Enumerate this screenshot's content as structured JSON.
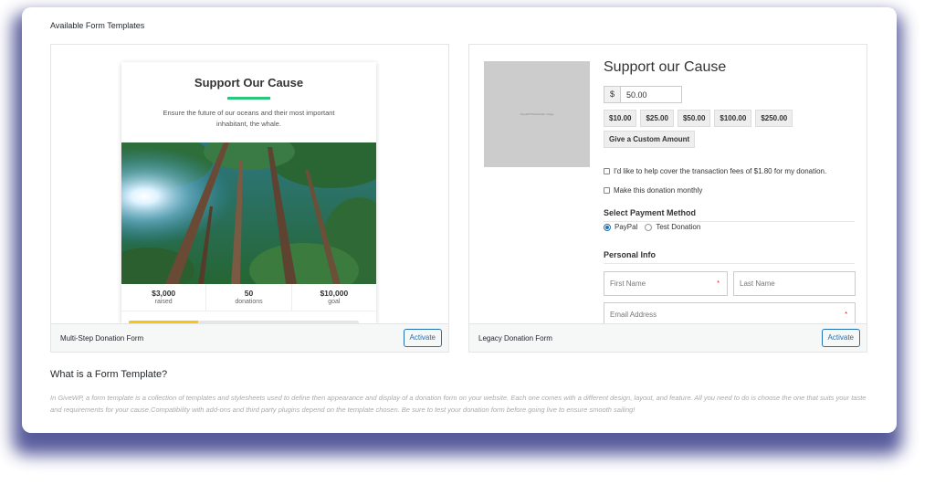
{
  "section_title": "Available Form Templates",
  "templates": [
    {
      "name": "Multi-Step Donation Form",
      "activate_label": "Activate",
      "preview": {
        "heading": "Support Our Cause",
        "description": "Ensure the future of our oceans and their most important inhabitant, the whale.",
        "stats": [
          {
            "value": "$3,000",
            "label": "raised"
          },
          {
            "value": "50",
            "label": "donations"
          },
          {
            "value": "$10,000",
            "label": "goal"
          }
        ],
        "progress_fraction": 0.3,
        "accent_color": "#28c77b",
        "progress_color": "#f5c518"
      }
    },
    {
      "name": "Legacy Donation Form",
      "activate_label": "Activate",
      "preview": {
        "image_placeholder": "GiveWP Placeholder Image",
        "heading": "Support our Cause",
        "currency_symbol": "$",
        "amount_value": "50.00",
        "levels": [
          "$10.00",
          "$25.00",
          "$50.00",
          "$100.00",
          "$250.00",
          "Give a Custom Amount"
        ],
        "fee_recovery_label": "I'd like to help cover the transaction fees of $1.80 for my donation.",
        "recurring_label": "Make this donation monthly",
        "payment_heading": "Select Payment Method",
        "gateways": [
          "PayPal",
          "Test Donation"
        ],
        "personal_info_heading": "Personal Info",
        "first_name_placeholder": "First Name",
        "last_name_placeholder": "Last Name",
        "email_placeholder": "Email Address",
        "required_marker": "*"
      }
    }
  ],
  "explanation": {
    "title": "What is a Form Template?",
    "text": "In GiveWP, a form template is a collection of templates and stylesheets used to define then appearance and display of a donation form on your website. Each one comes with a different design, layout, and feature. All you need to do is choose the one that suits your taste and requirements for your cause.Compatibility with add-ons and third party plugins depend on the template chosen. Be sure to test your donation form before going live to ensure smooth sailing!"
  },
  "colors": {
    "primary_button": "#2271b1",
    "panel_shadow": "#3a3f8a"
  }
}
